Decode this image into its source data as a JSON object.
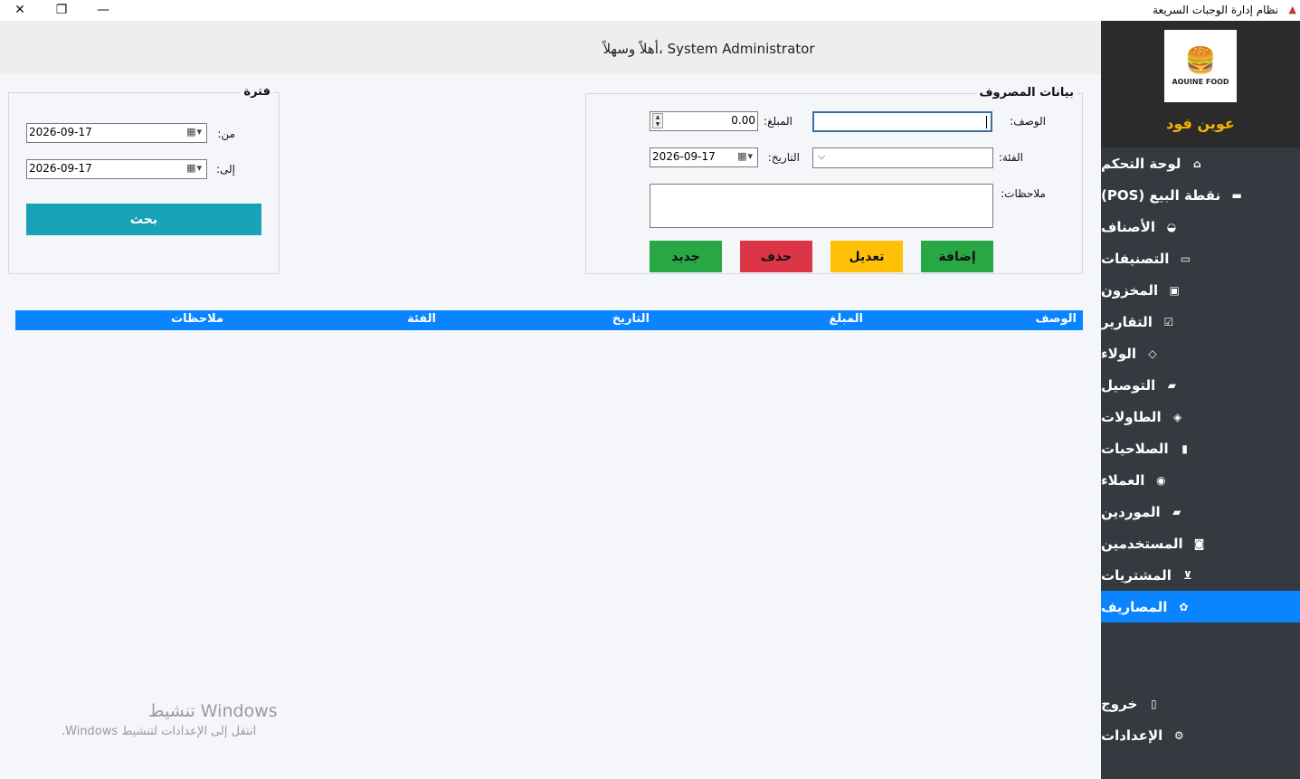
{
  "window": {
    "title": "نظام إدارة الوجبات السريعة",
    "close_glyph": "✕",
    "max_glyph": "❐",
    "min_glyph": "—"
  },
  "header": {
    "welcome": "أهلاً وسهلاً، System Administrator"
  },
  "expense_form": {
    "legend": "بيانات المصروف",
    "description_label": "الوصف:",
    "description_value": "",
    "amount_label": "المبلغ:",
    "amount_value": "0.00",
    "category_label": "الفئة:",
    "category_value": "",
    "date_label": "التاريخ:",
    "date_value": "2026-09-17",
    "notes_label": "ملاحظات:",
    "notes_value": "",
    "buttons": {
      "add": "إضافة",
      "edit": "تعديل",
      "delete": "حذف",
      "new": "جديد"
    }
  },
  "filter": {
    "legend": "فترة",
    "from_label": "من:",
    "from_value": "2026-09-17",
    "to_label": "إلى:",
    "to_value": "2026-09-17",
    "search_button": "بحث"
  },
  "grid": {
    "columns": [
      "الوصف",
      "المبلغ",
      "التاريخ",
      "الفئة",
      "ملاحظات"
    ]
  },
  "watermark": {
    "line1": "تنشيط Windows",
    "line2": "انتقل إلى الإعدادات لتنشيط Windows."
  },
  "sidebar": {
    "logo_text": "AOUINE FOOD",
    "brand": "عوين فود",
    "items": [
      {
        "label": "لوحة التحكم",
        "icon": "home-icon",
        "glyph": "⌂"
      },
      {
        "label": "نقطة البيع (POS)",
        "icon": "cash-register-icon",
        "glyph": "▬"
      },
      {
        "label": "الأصناف",
        "icon": "burger-icon",
        "glyph": "◒"
      },
      {
        "label": "التصنيفات",
        "icon": "folder-icon",
        "glyph": "▭"
      },
      {
        "label": "المخزون",
        "icon": "box-icon",
        "glyph": "▣"
      },
      {
        "label": "التقارير",
        "icon": "report-icon",
        "glyph": "☑"
      },
      {
        "label": "الولاء",
        "icon": "diamond-icon",
        "glyph": "◇"
      },
      {
        "label": "التوصيل",
        "icon": "truck-icon",
        "glyph": "▰"
      },
      {
        "label": "الطاولات",
        "icon": "table-icon",
        "glyph": "◈"
      },
      {
        "label": "الصلاحيات",
        "icon": "lock-icon",
        "glyph": "▮"
      },
      {
        "label": "العملاء",
        "icon": "user-icon",
        "glyph": "◉"
      },
      {
        "label": "الموردين",
        "icon": "supplier-truck-icon",
        "glyph": "▰"
      },
      {
        "label": "المستخدمين",
        "icon": "users-icon",
        "glyph": "◙"
      },
      {
        "label": "المشتريات",
        "icon": "cart-icon",
        "glyph": "⊻"
      },
      {
        "label": "المصاريف",
        "icon": "money-icon",
        "glyph": "✿"
      }
    ],
    "bottom_items": [
      {
        "label": "خروج",
        "icon": "exit-icon",
        "glyph": "▯"
      },
      {
        "label": "الإعدادات",
        "icon": "gear-icon",
        "glyph": "⚙"
      }
    ],
    "active_index": 14
  }
}
